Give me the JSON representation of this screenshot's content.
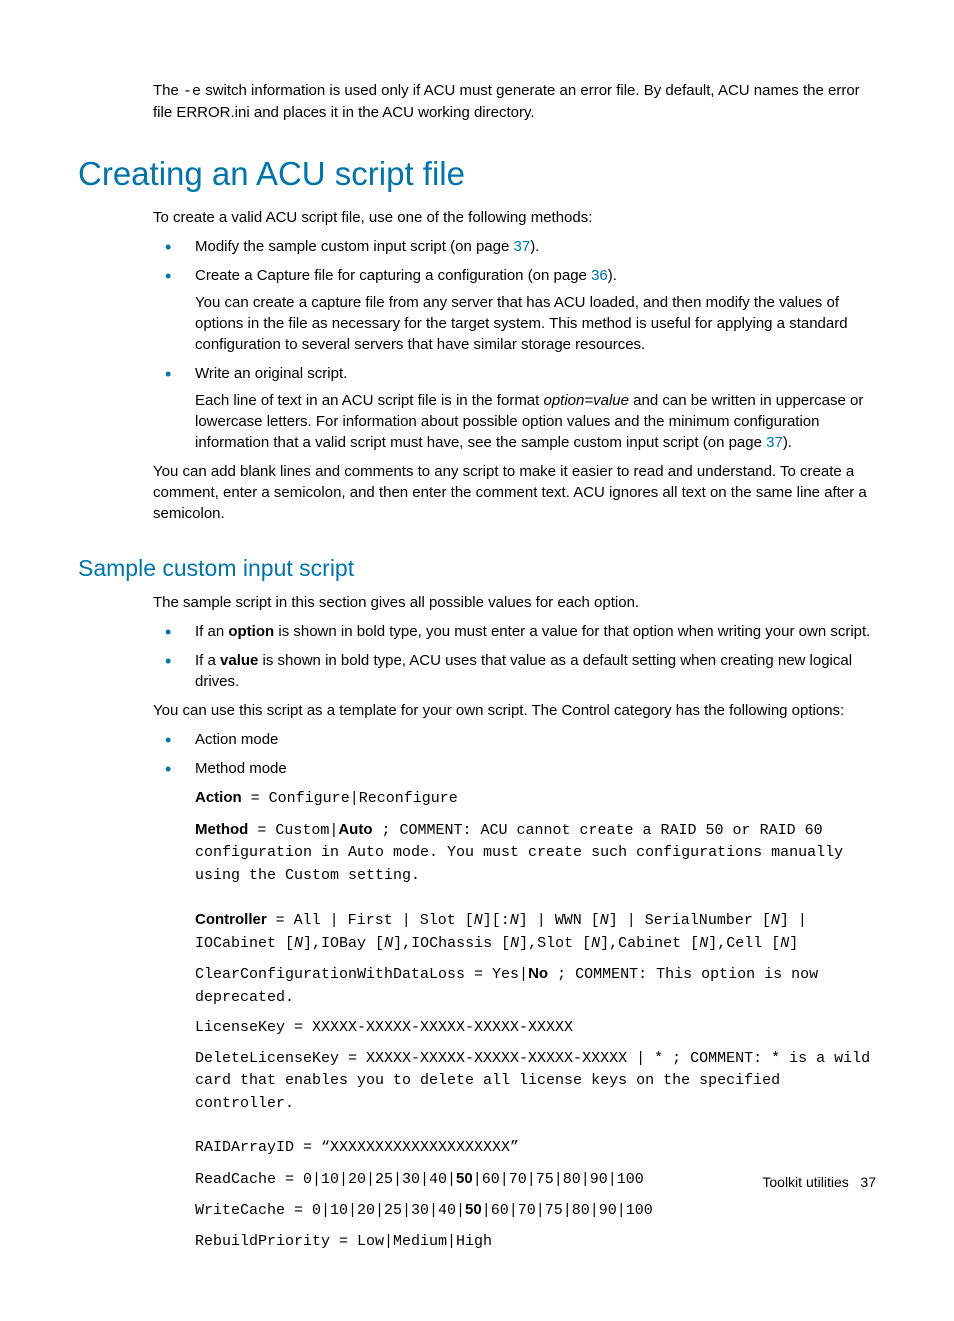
{
  "top": {
    "p1a": "The ",
    "p1b": "-e",
    "p1c": " switch information is used only if ACU must generate an error file. By default, ACU names the error file ERROR.ini and places it in the ACU working directory."
  },
  "h1": "Creating an ACU script file",
  "sec1": {
    "intro": "To create a valid ACU script file, use one of the following methods:",
    "li1a": "Modify the sample custom input script (on page ",
    "li1link": "37",
    "li1b": ").",
    "li2a": "Create a Capture file for capturing a configuration (on page ",
    "li2link": "36",
    "li2b": ").",
    "li2p": "You can create a capture file from any server that has ACU loaded, and then modify the values of options in the file as necessary for the target system. This method is useful for applying a standard configuration to several servers that have similar storage resources.",
    "li3": "Write an original script.",
    "li3pa": "Each line of text in an ACU script file is in the format ",
    "li3pb": "option=value",
    "li3pc": " and can be written in uppercase or lowercase letters. For information about possible option values and the minimum configuration information that a valid script must have, see the sample custom input script (on page ",
    "li3plink": "37",
    "li3pd": ").",
    "outro": "You can add blank lines and comments to any script to make it easier to read and understand. To create a comment, enter a semicolon, and then enter the comment text. ACU ignores all text on the same line after a semicolon."
  },
  "h2": "Sample custom input script",
  "sec2": {
    "intro": "The sample script in this section gives all possible values for each option.",
    "li1a": "If an ",
    "li1b": "option",
    "li1c": " is shown in bold type, you must enter a value for that option when writing your own script.",
    "li2a": "If a ",
    "li2b": "value",
    "li2c": " is shown in bold type, ACU uses that value as a default setting when creating new logical drives.",
    "p2": "You can use this script as a template for your own script. The Control category has the following options:",
    "li3": "Action mode",
    "li4": "Method mode"
  },
  "code": {
    "action_label": "Action",
    "action_rest": " = Configure|Reconfigure",
    "method_label": "Method",
    "method_mid": " = Custom|",
    "method_bold": "Auto",
    "method_rest": " ; COMMENT: ACU cannot create a RAID 50 or RAID 60 configuration in Auto mode. You must create such configurations manually using the Custom setting.",
    "controller_label": "Controller",
    "controller_a": " = All | First | Slot [",
    "n": "N",
    "controller_b": "][:",
    "controller_c": "] | WWN [",
    "controller_d": "] | SerialNumber [",
    "controller_e": "] | IOCabinet [",
    "controller_f": "],IOBay [",
    "controller_g": "],IOChassis [",
    "controller_h": "],Slot [",
    "controller_i": "],Cabinet [",
    "controller_j": "],Cell [",
    "controller_k": "]",
    "clear_a": "ClearConfigurationWithDataLoss = Yes|",
    "clear_bold": "No",
    "clear_b": " ; COMMENT: This option is now deprecated.",
    "license": "LicenseKey = XXXXX-XXXXX-XXXXX-XXXXX-XXXXX",
    "delete": "DeleteLicenseKey = XXXXX-XXXXX-XXXXX-XXXXX-XXXXX | * ; COMMENT: * is a wild card that enables you to delete all license keys on the specified controller.",
    "raid": "RAIDArrayID = “XXXXXXXXXXXXXXXXXXXX”",
    "read_a": "ReadCache = 0|10|20|25|30|40|",
    "read_bold": "50",
    "read_b": "|60|70|75|80|90|100",
    "write_a": "WriteCache = 0|10|20|25|30|40|",
    "write_bold": "50",
    "write_b": "|60|70|75|80|90|100",
    "rebuild": "RebuildPriority = Low|Medium|High"
  },
  "footer": {
    "label": "Toolkit utilities",
    "page": "37"
  }
}
